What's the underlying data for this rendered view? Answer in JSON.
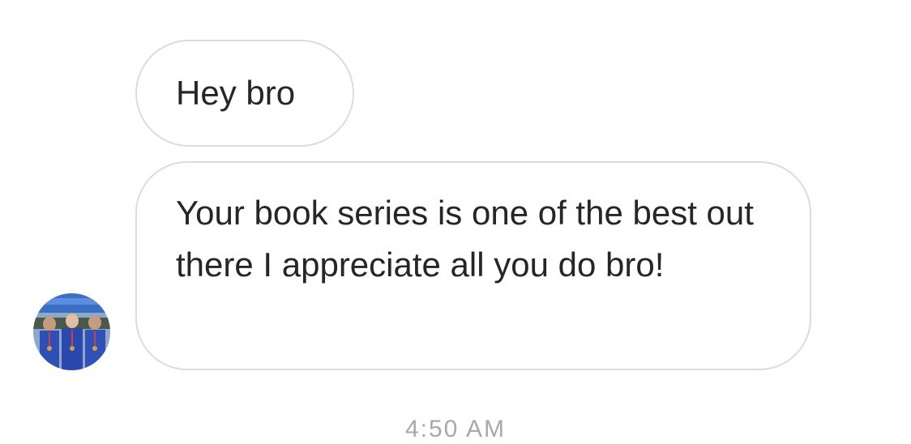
{
  "messages": [
    {
      "text": "Hey bro"
    },
    {
      "text": "Your book series is one of the best out there I appreciate all you do bro!"
    }
  ],
  "timestamp": "4:50 AM",
  "colors": {
    "bubble_border": "#dcdcdc",
    "text": "#262626",
    "timestamp": "#a8a8a8"
  },
  "icons": {
    "avatar": "profile-photo-avatar"
  }
}
